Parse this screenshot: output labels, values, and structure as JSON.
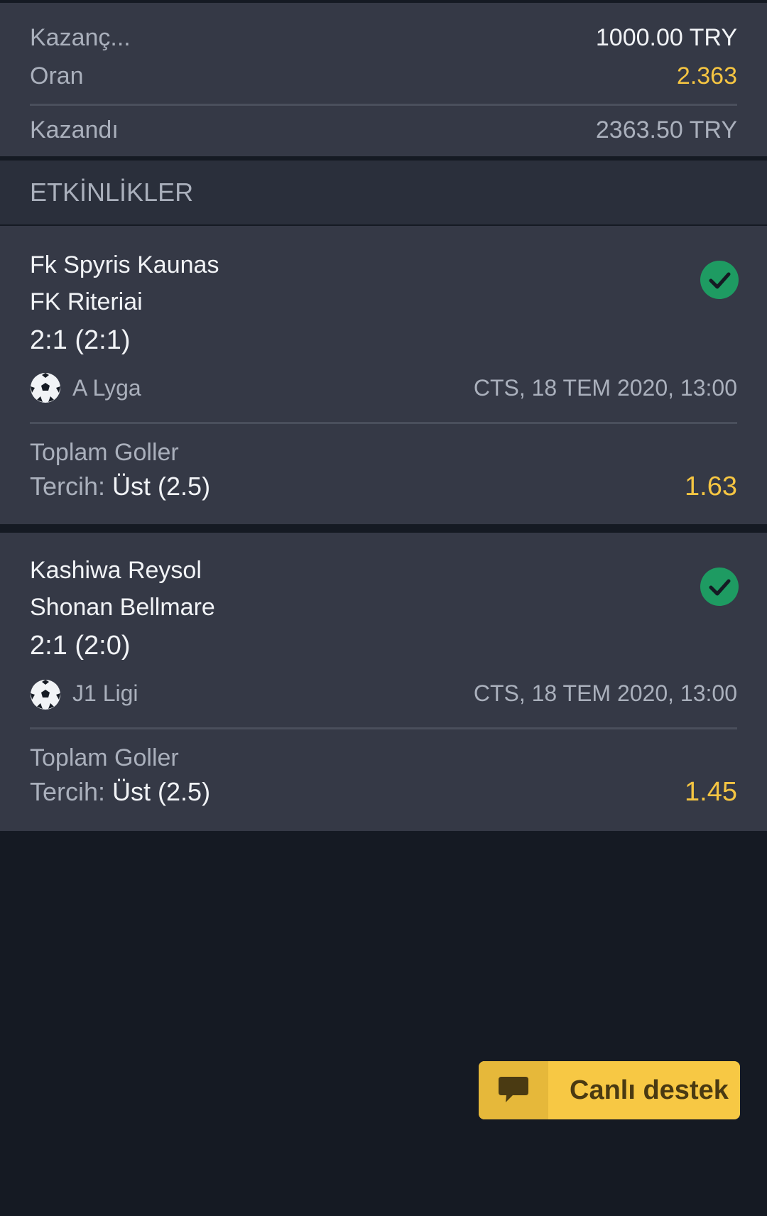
{
  "summary": {
    "stake_label": "Kazanç...",
    "stake_value": "1000.00 TRY",
    "odds_label": "Oran",
    "odds_value": "2.363",
    "won_label": "Kazandı",
    "won_value": "2363.50 TRY"
  },
  "section": {
    "title": "ETKİNLİKLER"
  },
  "events": [
    {
      "home": "Fk Spyris Kaunas",
      "away": "FK Riteriai",
      "score": "2:1 (2:1)",
      "league": "A Lyga",
      "date": "CTS, 18 TEM 2020, 13:00",
      "market": "Toplam Goller",
      "choice_label": "Tercih:",
      "choice_value": "Üst (2.5)",
      "odd": "1.63",
      "status_icon": "check-circle-icon"
    },
    {
      "home": "Kashiwa Reysol",
      "away": "Shonan Bellmare",
      "score": "2:1 (2:0)",
      "league": "J1 Ligi",
      "date": "CTS, 18 TEM 2020, 13:00",
      "market": "Toplam Goller",
      "choice_label": "Tercih:",
      "choice_value": "Üst (2.5)",
      "odd": "1.45",
      "status_icon": "check-circle-icon"
    }
  ],
  "support": {
    "label": "Canlı destek",
    "icon": "chat-bubble-icon"
  },
  "colors": {
    "accent": "#f5c542",
    "success": "#1e9b62",
    "panel": "#353946",
    "background": "#151a23"
  }
}
